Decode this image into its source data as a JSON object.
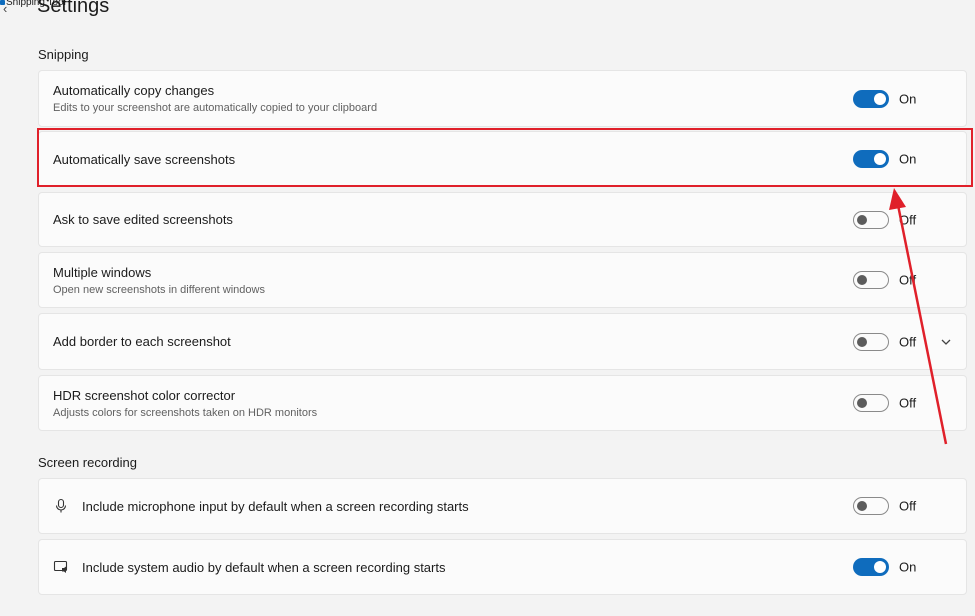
{
  "window": {
    "app_title": "Snipping Tool",
    "page_title": "Settings"
  },
  "sections": {
    "snipping": {
      "title": "Snipping",
      "items": [
        {
          "label": "Automatically copy changes",
          "desc": "Edits to your screenshot are automatically copied to your clipboard",
          "toggle": "on",
          "state": "On"
        },
        {
          "label": "Automatically save screenshots",
          "state": "On",
          "toggle": "on"
        },
        {
          "label": "Ask to save edited screenshots",
          "state": "Off",
          "toggle": "off"
        },
        {
          "label": "Multiple windows",
          "desc": "Open new screenshots in different windows",
          "state": "Off",
          "toggle": "off"
        },
        {
          "label": "Add border to each screenshot",
          "state": "Off",
          "toggle": "off",
          "expandable": true
        },
        {
          "label": "HDR screenshot color corrector",
          "desc": "Adjusts colors for screenshots taken on HDR monitors",
          "state": "Off",
          "toggle": "off"
        }
      ]
    },
    "screen_recording": {
      "title": "Screen recording",
      "items": [
        {
          "label": "Include microphone input by default when a screen recording starts",
          "icon": "microphone-icon",
          "state": "Off",
          "toggle": "off"
        },
        {
          "label": "Include system audio by default when a screen recording starts",
          "icon": "system-audio-icon",
          "state": "On",
          "toggle": "on"
        }
      ]
    }
  },
  "annotation": {
    "highlight_color": "#e0202a",
    "highlighted_item": "Automatically save screenshots"
  },
  "colors": {
    "accent": "#0f6cbd",
    "background": "#f3f3f3",
    "card": "#fbfbfb"
  }
}
